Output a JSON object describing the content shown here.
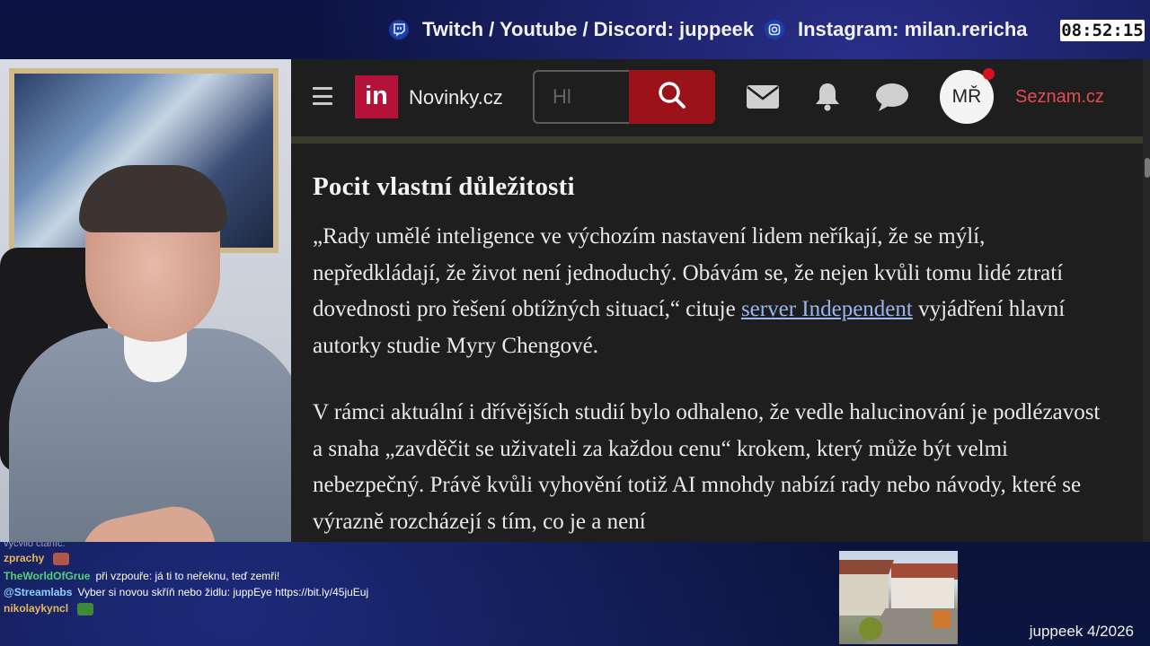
{
  "overlay": {
    "socials": [
      {
        "icon": "twitch-icon",
        "text": "Twitch / Youtube / Discord: juppeek"
      },
      {
        "icon": "instagram-icon",
        "text": "Instagram: milan.rericha"
      }
    ],
    "clock": "08:52:15",
    "credit": "juppeek 4/2026"
  },
  "site": {
    "logo_mark": "in",
    "logo_name": "Novinky.cz",
    "search_placeholder": "Hl",
    "avatar_initials": "MŘ",
    "seznam_link": "Seznam.cz",
    "icons": [
      "menu-icon",
      "search-icon",
      "mail-icon",
      "bell-icon",
      "chat-icon"
    ],
    "accent": "#b5123a",
    "search_button_color": "#9c1219",
    "link_color": "#e54b53"
  },
  "article": {
    "heading": "Pocit vlastní důležitosti",
    "p1_before": "„Rady umělé inteligence ve výchozím nastavení lidem neříkají, že se mýlí, nepředkládají, že život není jednoduchý. Obávám se, že nejen kvůli tomu lidé ztratí dovednosti pro řešení obtížných situací,“ cituje ",
    "p1_link": "server Independent",
    "p1_after": " vyjádření hlavní autorky studie Myry Chengové.",
    "p2": "V rámci aktuální i dřívějších studií bylo odhaleno, že vedle halucinování je podlézavost a snaha „zavděčit se uživateli za každou cenu“ krokem, který může být velmi nebezpečný. Právě kvůli vyhovění totiž AI mnohdy nabízí rady nebo návody, které se výrazně rozcházejí s tím, co je a není"
  },
  "chat": {
    "cut_line": "vyčvilo čtáníč.",
    "messages": [
      {
        "user": "zprachy",
        "color": "#e8b75a",
        "text": ""
      },
      {
        "user": "TheWorldOfGrue",
        "color": "#4fd07a",
        "text": "při vzpouře: já ti to neřeknu, teď zemři!"
      },
      {
        "user": "@Streamlabs",
        "color": "#8fd0ff",
        "text": "Vyber si novou skříň nebo židlu: juppEye https://bit.ly/45juEuj"
      },
      {
        "user": "nikolaykyncl",
        "color": "#e8b75a",
        "text": ""
      }
    ]
  }
}
